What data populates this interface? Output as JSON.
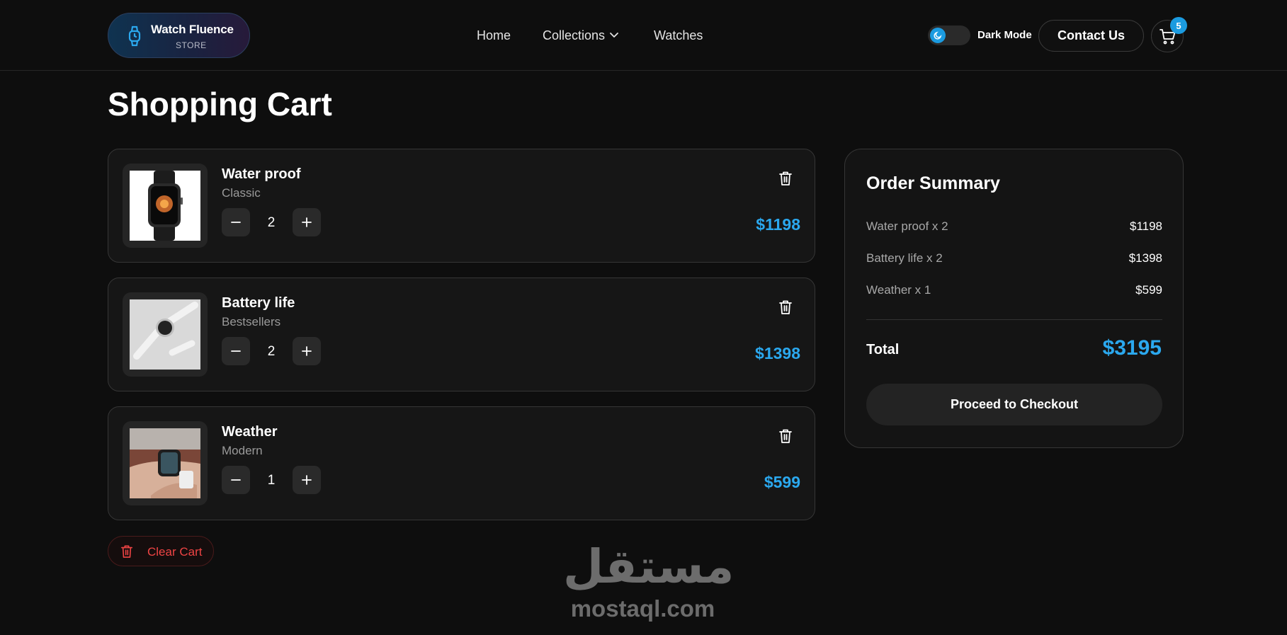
{
  "brand": {
    "name": "Watch Fluence",
    "tagline": "STORE"
  },
  "nav": {
    "home": "Home",
    "collections": "Collections",
    "watches": "Watches"
  },
  "header": {
    "dark_mode_label": "Dark Mode",
    "contact_label": "Contact Us",
    "cart_count": "5"
  },
  "page": {
    "title": "Shopping Cart"
  },
  "cart": {
    "items": [
      {
        "name": "Water proof",
        "category": "Classic",
        "quantity": "2",
        "price": "$1198"
      },
      {
        "name": "Battery life",
        "category": "Bestsellers",
        "quantity": "2",
        "price": "$1398"
      },
      {
        "name": "Weather",
        "category": "Modern",
        "quantity": "1",
        "price": "$599"
      }
    ],
    "clear_label": "Clear Cart"
  },
  "summary": {
    "title": "Order Summary",
    "rows": [
      {
        "label": "Water proof x 2",
        "amount": "$1198"
      },
      {
        "label": "Battery life x 2",
        "amount": "$1398"
      },
      {
        "label": "Weather x 1",
        "amount": "$599"
      }
    ],
    "total_label": "Total",
    "total_amount": "$3195",
    "checkout_label": "Proceed to Checkout"
  },
  "watermark": {
    "arabic": "مستقل",
    "latin": "mostaql.com"
  },
  "colors": {
    "accent": "#2ba8ee",
    "danger": "#ee4444",
    "background": "#0e0e0e"
  }
}
